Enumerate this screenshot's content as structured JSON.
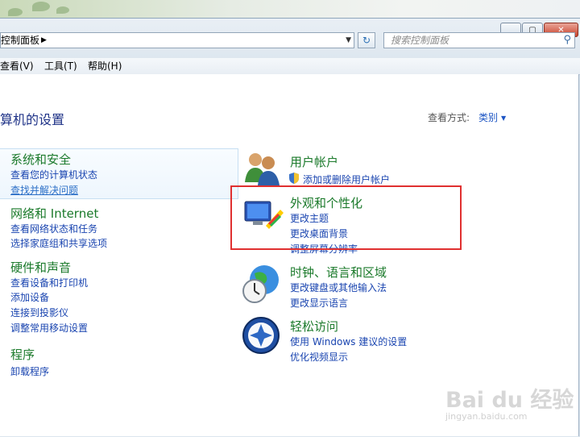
{
  "window": {
    "address": "控制面板",
    "search_placeholder": "搜索控制面板"
  },
  "menu": {
    "view": "查看(V)",
    "tools": "工具(T)",
    "help": "帮助(H)"
  },
  "page": {
    "title": "算机的设置",
    "view_by_label": "查看方式:",
    "view_by_value": "类别"
  },
  "left": [
    {
      "title": "系统和安全",
      "links": [
        "查看您的计算机状态",
        "查找并解决问题"
      ]
    },
    {
      "title": "网络和 Internet",
      "links": [
        "查看网络状态和任务",
        "选择家庭组和共享选项"
      ]
    },
    {
      "title": "硬件和声音",
      "links": [
        "查看设备和打印机",
        "添加设备",
        "连接到投影仪",
        "调整常用移动设置"
      ]
    },
    {
      "title": "程序",
      "links": [
        "卸载程序"
      ]
    }
  ],
  "right": [
    {
      "title": "用户帐户",
      "links": [
        "添加或删除用户帐户"
      ],
      "icon": "users-icon"
    },
    {
      "title": "外观和个性化",
      "links": [
        "更改主题",
        "更改桌面背景",
        "调整屏幕分辨率"
      ],
      "icon": "appearance-icon"
    },
    {
      "title": "时钟、语言和区域",
      "links": [
        "更改键盘或其他输入法",
        "更改显示语言"
      ],
      "icon": "clock-globe-icon"
    },
    {
      "title": "轻松访问",
      "links": [
        "使用 Windows 建议的设置",
        "优化视频显示"
      ],
      "icon": "ease-of-access-icon"
    }
  ],
  "watermark": {
    "brand": "Bai du 经验",
    "url": "jingyan.baidu.com"
  },
  "colors": {
    "category_green": "#1b7a2b",
    "link_blue": "#1a45b0",
    "highlight_red": "#e03030"
  }
}
